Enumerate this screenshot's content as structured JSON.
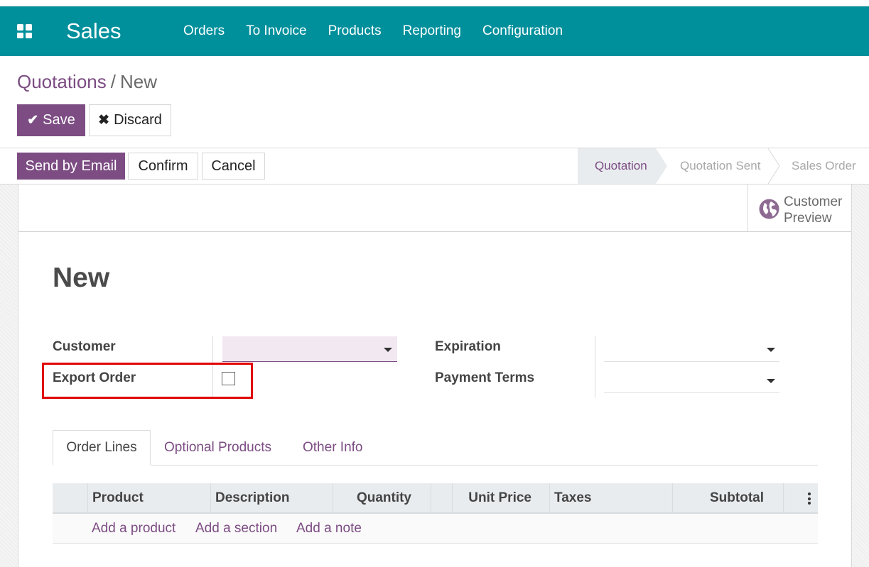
{
  "navbar": {
    "app_name": "Sales",
    "menu": [
      "Orders",
      "To Invoice",
      "Products",
      "Reporting",
      "Configuration"
    ]
  },
  "breadcrumb": {
    "parent": "Quotations",
    "separator": "/",
    "current": "New"
  },
  "actions": {
    "save": "Save",
    "discard": "Discard"
  },
  "statusbar": {
    "send_email": "Send by Email",
    "confirm": "Confirm",
    "cancel": "Cancel",
    "stages": [
      "Quotation",
      "Quotation Sent",
      "Sales Order"
    ],
    "active_stage": "Quotation"
  },
  "button_box": {
    "preview_line1": "Customer",
    "preview_line2": "Preview"
  },
  "form": {
    "title": "New",
    "customer_label": "Customer",
    "customer_value": "",
    "export_order_label": "Export Order",
    "export_order_checked": false,
    "expiration_label": "Expiration",
    "expiration_value": "",
    "payment_terms_label": "Payment Terms",
    "payment_terms_value": ""
  },
  "tabs": [
    "Order Lines",
    "Optional Products",
    "Other Info"
  ],
  "order_lines": {
    "columns": [
      "Product",
      "Description",
      "Quantity",
      "Unit Price",
      "Taxes",
      "Subtotal"
    ],
    "add_links": [
      "Add a product",
      "Add a section",
      "Add a note"
    ]
  },
  "colors": {
    "navbar": "#00909c",
    "primary": "#7c4c83",
    "highlight": "#e00000"
  }
}
